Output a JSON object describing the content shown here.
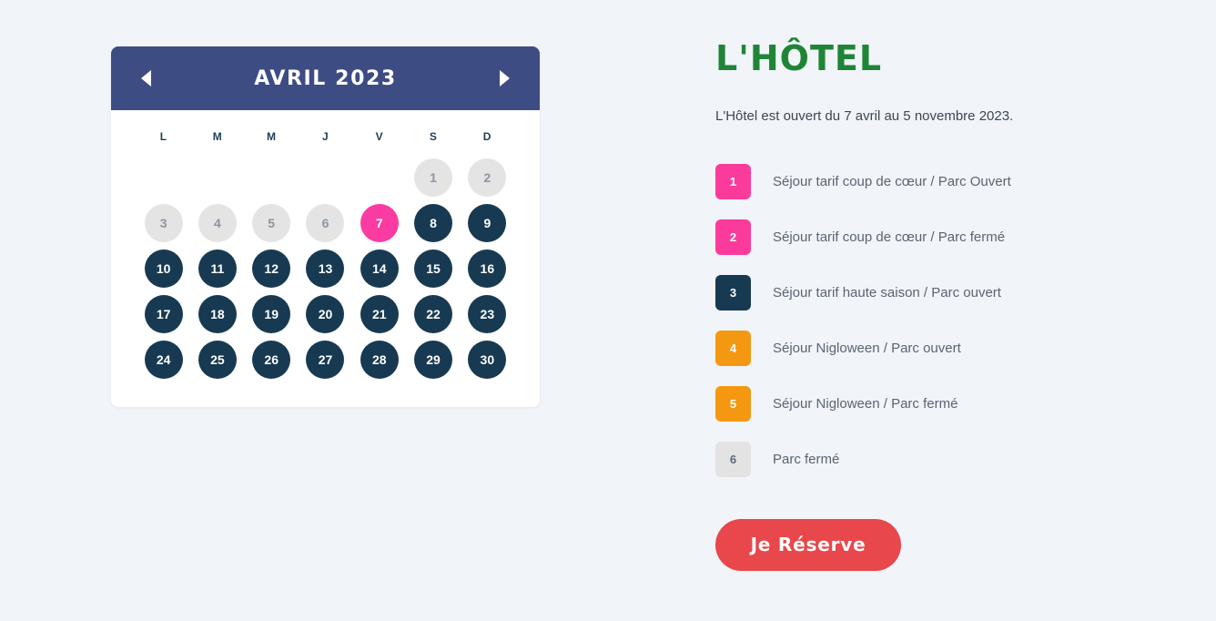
{
  "page": {
    "background_color": "#f1f4f9"
  },
  "calendar": {
    "title": "AVRIL 2023",
    "prev_icon": "chevron-left-icon",
    "next_icon": "chevron-right-icon",
    "weekdays": [
      "L",
      "M",
      "M",
      "J",
      "V",
      "S",
      "D"
    ],
    "leading_blanks": 5,
    "days": [
      {
        "n": "1",
        "state": "closed"
      },
      {
        "n": "2",
        "state": "closed"
      },
      {
        "n": "3",
        "state": "closed"
      },
      {
        "n": "4",
        "state": "closed"
      },
      {
        "n": "5",
        "state": "closed"
      },
      {
        "n": "6",
        "state": "closed"
      },
      {
        "n": "7",
        "state": "pink"
      },
      {
        "n": "8",
        "state": "open"
      },
      {
        "n": "9",
        "state": "open"
      },
      {
        "n": "10",
        "state": "open"
      },
      {
        "n": "11",
        "state": "open"
      },
      {
        "n": "12",
        "state": "open"
      },
      {
        "n": "13",
        "state": "open"
      },
      {
        "n": "14",
        "state": "open"
      },
      {
        "n": "15",
        "state": "open"
      },
      {
        "n": "16",
        "state": "open"
      },
      {
        "n": "17",
        "state": "open"
      },
      {
        "n": "18",
        "state": "open"
      },
      {
        "n": "19",
        "state": "open"
      },
      {
        "n": "20",
        "state": "open"
      },
      {
        "n": "21",
        "state": "open"
      },
      {
        "n": "22",
        "state": "open"
      },
      {
        "n": "23",
        "state": "open"
      },
      {
        "n": "24",
        "state": "open"
      },
      {
        "n": "25",
        "state": "open"
      },
      {
        "n": "26",
        "state": "open"
      },
      {
        "n": "27",
        "state": "open"
      },
      {
        "n": "28",
        "state": "open"
      },
      {
        "n": "29",
        "state": "open"
      },
      {
        "n": "30",
        "state": "open"
      }
    ],
    "colors": {
      "header": "#3e4c84",
      "open": "#173a52",
      "closed": "#e4e4e4",
      "pink": "#fa3ba2",
      "card": "#ffffff"
    }
  },
  "info": {
    "title": "L'HÔTEL",
    "subtitle": "L'Hôtel est ouvert du 7 avril au 5 novembre 2023.",
    "title_color": "#1f8536",
    "legend": [
      {
        "number": "1",
        "label": "Séjour tarif coup de cœur / Parc Ouvert",
        "color": "#fb3b9c",
        "text_color": "#ffffff"
      },
      {
        "number": "2",
        "label": "Séjour tarif coup de cœur / Parc fermé",
        "color": "#fb3b9c",
        "text_color": "#ffffff"
      },
      {
        "number": "3",
        "label": "Séjour tarif haute saison / Parc ouvert",
        "color": "#173a52",
        "text_color": "#ffffff"
      },
      {
        "number": "4",
        "label": "Séjour Nigloween / Parc ouvert",
        "color": "#f59811",
        "text_color": "#ffffff"
      },
      {
        "number": "5",
        "label": "Séjour Nigloween / Parc fermé",
        "color": "#f59811",
        "text_color": "#ffffff"
      },
      {
        "number": "6",
        "label": "Parc fermé",
        "color": "#e3e3e3",
        "text_color": "#5f6a77"
      }
    ],
    "reserve_button": {
      "label": "Je Réserve",
      "color": "#e8474b"
    }
  }
}
